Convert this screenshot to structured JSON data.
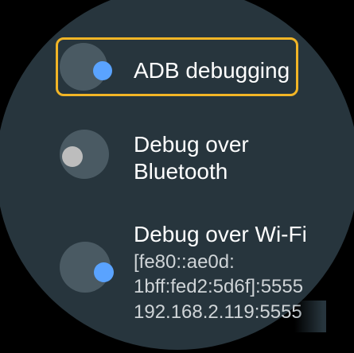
{
  "settings": {
    "items": [
      {
        "label": "ADB debugging",
        "enabled": true
      },
      {
        "label_line1": "Debug over",
        "label_line2": "Bluetooth",
        "enabled": false
      },
      {
        "label": "Debug over Wi-Fi",
        "detail_line1": "[fe80::ae0d:",
        "detail_line2": "1bff:fed2:5d6f]:5555",
        "detail_line3": "192.168.2.119:5555",
        "enabled": true
      }
    ]
  },
  "colors": {
    "background": "#27353d",
    "toggle_on": "#5aa3ff",
    "toggle_off": "#bdbdbd",
    "focus_ring": "#f2b526"
  },
  "icons": {
    "toggle_on": "toggle-on-icon",
    "toggle_off": "toggle-off-icon"
  }
}
